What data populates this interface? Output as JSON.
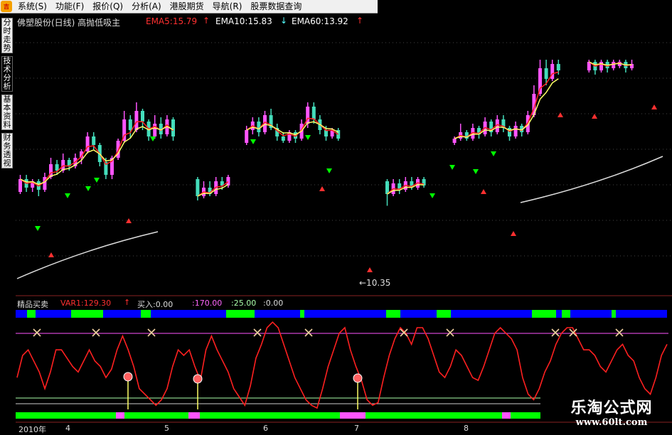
{
  "menu": [
    {
      "label": "系统(S)"
    },
    {
      "label": "功能(F)"
    },
    {
      "label": "报价(Q)"
    },
    {
      "label": "分析(A)"
    },
    {
      "label": "港股期货"
    },
    {
      "label": "导航(R)"
    },
    {
      "label": "股票数据查询"
    }
  ],
  "side_tabs": [
    "分时走势",
    "技术分析",
    "基本资料",
    "财务透视"
  ],
  "header": {
    "title": "佛塑股份(日线) 高抛低吸主",
    "ema5": "EMA5:15.79",
    "ema10": "EMA10:15.83",
    "ema60": "EMA60:13.92",
    "up_arrow": "↑",
    "down_arrow": "↓"
  },
  "price_low_label": "←10.35",
  "indicator": {
    "name": "精品买卖",
    "var1": "VAR1:129.30",
    "var1_arrow": "↑",
    "buy": "买入:0.00",
    "v170": ":170.00",
    "v25": ":25.00",
    "v0": ":0.00"
  },
  "x_axis": {
    "year": "2010年",
    "months": [
      "4",
      "5",
      "6",
      "7",
      "8"
    ]
  },
  "watermark": {
    "title": "乐淘公式网",
    "url": "www.60lt.com"
  },
  "colors": {
    "up": "#ff55ff",
    "down": "#44ddbb",
    "ema_fast": "#ff2020",
    "ema_mid": "#ffff66",
    "ema60": "#dddddd",
    "signal": "#00ff00",
    "top_bar": "#0000ff",
    "kline_red": "#ff2020"
  },
  "chart_data": {
    "type": "candlestick",
    "price_extremes": {
      "low": 10.35
    },
    "ema": {
      "EMA5": 15.79,
      "EMA10": 15.83,
      "EMA60": 13.92
    },
    "indicator_levels": [
      170,
      25,
      0
    ],
    "var1_last": 129.3,
    "osc_series": [
      60,
      100,
      110,
      90,
      70,
      40,
      70,
      110,
      110,
      95,
      80,
      70,
      90,
      110,
      90,
      80,
      60,
      75,
      110,
      135,
      110,
      80,
      40,
      30,
      20,
      10,
      20,
      40,
      80,
      110,
      100,
      110,
      80,
      55,
      110,
      135,
      110,
      90,
      70,
      40,
      25,
      10,
      45,
      95,
      120,
      150,
      160,
      150,
      120,
      90,
      60,
      40,
      20,
      10,
      5,
      40,
      80,
      110,
      140,
      150,
      110,
      80,
      55,
      20,
      10,
      15,
      60,
      100,
      130,
      150,
      140,
      120,
      150,
      150,
      130,
      100,
      70,
      60,
      80,
      110,
      100,
      80,
      60,
      55,
      80,
      110,
      140,
      150,
      140,
      130,
      110,
      60,
      30,
      20,
      40,
      70,
      90,
      120,
      140,
      150,
      150,
      130,
      110,
      110,
      100,
      80,
      70,
      90,
      110,
      120,
      100,
      90,
      60,
      40,
      30,
      60,
      100,
      120
    ],
    "candles": [
      {
        "o": 11.0,
        "c": 11.6,
        "h": 11.8,
        "l": 10.9
      },
      {
        "o": 11.6,
        "c": 11.2,
        "h": 11.8,
        "l": 11.0
      },
      {
        "o": 11.2,
        "c": 11.5,
        "h": 11.6,
        "l": 11.0
      },
      {
        "o": 11.5,
        "c": 11.1,
        "h": 11.6,
        "l": 10.8
      },
      {
        "o": 11.1,
        "c": 11.7,
        "h": 11.9,
        "l": 11.0
      },
      {
        "o": 11.7,
        "c": 12.3,
        "h": 12.6,
        "l": 11.6
      },
      {
        "o": 12.3,
        "c": 12.0,
        "h": 12.5,
        "l": 11.8
      },
      {
        "o": 12.0,
        "c": 12.5,
        "h": 12.8,
        "l": 11.9
      },
      {
        "o": 12.5,
        "c": 12.2,
        "h": 12.6,
        "l": 12.0
      },
      {
        "o": 12.2,
        "c": 12.6,
        "h": 12.8,
        "l": 12.1
      },
      {
        "o": 12.6,
        "c": 12.9,
        "h": 13.0,
        "l": 12.3
      },
      {
        "o": 12.9,
        "c": 13.6,
        "h": 13.8,
        "l": 12.8
      },
      {
        "o": 13.6,
        "c": 13.2,
        "h": 13.8,
        "l": 13.0
      },
      {
        "o": 13.2,
        "c": 12.4,
        "h": 13.3,
        "l": 12.2
      },
      {
        "o": 12.4,
        "c": 11.8,
        "h": 12.6,
        "l": 11.6
      },
      {
        "o": 11.8,
        "c": 12.6,
        "h": 12.7,
        "l": 11.6
      },
      {
        "o": 12.6,
        "c": 13.4,
        "h": 13.5,
        "l": 12.5
      },
      {
        "o": 13.4,
        "c": 14.4,
        "h": 14.8,
        "l": 13.3
      },
      {
        "o": 14.4,
        "c": 13.9,
        "h": 14.6,
        "l": 13.5
      },
      {
        "o": 13.9,
        "c": 14.8,
        "h": 15.2,
        "l": 13.8
      },
      {
        "o": 14.8,
        "c": 14.3,
        "h": 14.9,
        "l": 13.9
      },
      {
        "o": 14.3,
        "c": 13.6,
        "h": 14.4,
        "l": 13.4
      },
      {
        "o": 13.6,
        "c": 14.2,
        "h": 14.6,
        "l": 13.5
      },
      {
        "o": 14.2,
        "c": 13.7,
        "h": 14.5,
        "l": 13.5
      },
      {
        "o": 13.7,
        "c": 14.4,
        "h": 14.6,
        "l": 13.6
      },
      {
        "o": 14.4,
        "c": 13.6,
        "h": 14.5,
        "l": 13.4
      },
      {
        "o": 11.6,
        "c": 10.8,
        "h": 11.7,
        "l": 10.6
      },
      {
        "o": 10.8,
        "c": 11.2,
        "h": 11.5,
        "l": 10.7
      },
      {
        "o": 11.2,
        "c": 10.9,
        "h": 11.5,
        "l": 10.8
      },
      {
        "o": 10.9,
        "c": 11.5,
        "h": 11.7,
        "l": 10.8
      },
      {
        "o": 11.5,
        "c": 11.3,
        "h": 11.7,
        "l": 11.1
      },
      {
        "o": 11.3,
        "c": 11.7,
        "h": 11.8,
        "l": 11.2
      },
      {
        "o": 13.3,
        "c": 13.9,
        "h": 14.1,
        "l": 13.2
      },
      {
        "o": 13.9,
        "c": 14.3,
        "h": 14.5,
        "l": 13.7
      },
      {
        "o": 14.3,
        "c": 13.8,
        "h": 14.5,
        "l": 13.6
      },
      {
        "o": 13.8,
        "c": 14.6,
        "h": 14.8,
        "l": 13.7
      },
      {
        "o": 14.6,
        "c": 14.0,
        "h": 14.9,
        "l": 13.9
      },
      {
        "o": 14.0,
        "c": 13.6,
        "h": 14.2,
        "l": 13.4
      },
      {
        "o": 13.6,
        "c": 13.4,
        "h": 13.8,
        "l": 13.3
      },
      {
        "o": 13.4,
        "c": 13.8,
        "h": 13.9,
        "l": 13.3
      },
      {
        "o": 13.8,
        "c": 13.5,
        "h": 13.9,
        "l": 13.3
      },
      {
        "o": 13.5,
        "c": 14.2,
        "h": 14.4,
        "l": 13.4
      },
      {
        "o": 14.2,
        "c": 15.0,
        "h": 15.2,
        "l": 14.0
      },
      {
        "o": 15.0,
        "c": 14.4,
        "h": 15.2,
        "l": 14.2
      },
      {
        "o": 14.4,
        "c": 13.9,
        "h": 14.6,
        "l": 13.7
      },
      {
        "o": 13.9,
        "c": 13.6,
        "h": 14.1,
        "l": 13.4
      },
      {
        "o": 13.6,
        "c": 13.9,
        "h": 14.0,
        "l": 13.5
      },
      {
        "o": 13.9,
        "c": 13.5,
        "h": 14.0,
        "l": 13.4
      },
      {
        "o": 11.5,
        "c": 10.9,
        "h": 11.6,
        "l": 10.35
      },
      {
        "o": 10.9,
        "c": 11.4,
        "h": 11.6,
        "l": 10.8
      },
      {
        "o": 11.4,
        "c": 11.1,
        "h": 11.6,
        "l": 10.9
      },
      {
        "o": 11.1,
        "c": 11.5,
        "h": 11.7,
        "l": 11.0
      },
      {
        "o": 11.5,
        "c": 11.2,
        "h": 11.7,
        "l": 11.1
      },
      {
        "o": 11.2,
        "c": 11.6,
        "h": 11.7,
        "l": 11.1
      },
      {
        "o": 11.6,
        "c": 11.3,
        "h": 11.7,
        "l": 11.2
      },
      {
        "o": 13.3,
        "c": 13.5,
        "h": 13.6,
        "l": 13.2
      },
      {
        "o": 13.5,
        "c": 13.8,
        "h": 14.2,
        "l": 13.4
      },
      {
        "o": 13.8,
        "c": 13.5,
        "h": 13.9,
        "l": 13.4
      },
      {
        "o": 13.5,
        "c": 14.0,
        "h": 14.2,
        "l": 13.4
      },
      {
        "o": 14.0,
        "c": 13.7,
        "h": 14.1,
        "l": 13.5
      },
      {
        "o": 13.7,
        "c": 14.3,
        "h": 14.5,
        "l": 13.6
      },
      {
        "o": 14.3,
        "c": 13.8,
        "h": 14.4,
        "l": 13.6
      },
      {
        "o": 13.8,
        "c": 14.4,
        "h": 14.6,
        "l": 13.7
      },
      {
        "o": 14.4,
        "c": 14.0,
        "h": 14.6,
        "l": 13.8
      },
      {
        "o": 14.0,
        "c": 13.6,
        "h": 14.1,
        "l": 13.4
      },
      {
        "o": 13.6,
        "c": 14.1,
        "h": 14.3,
        "l": 13.5
      },
      {
        "o": 14.1,
        "c": 13.8,
        "h": 14.2,
        "l": 13.6
      },
      {
        "o": 13.8,
        "c": 14.6,
        "h": 14.8,
        "l": 13.7
      },
      {
        "o": 14.6,
        "c": 15.6,
        "h": 16.0,
        "l": 14.5
      },
      {
        "o": 15.6,
        "c": 16.8,
        "h": 17.2,
        "l": 15.5
      },
      {
        "o": 16.8,
        "c": 16.3,
        "h": 17.2,
        "l": 16.0
      },
      {
        "o": 16.3,
        "c": 17.0,
        "h": 17.2,
        "l": 16.2
      },
      {
        "o": 17.0,
        "c": 16.7,
        "h": 17.2,
        "l": 16.5
      },
      {
        "o": 16.7,
        "c": 17.1,
        "h": 17.2,
        "l": 16.6
      },
      {
        "o": 17.1,
        "c": 16.7,
        "h": 17.2,
        "l": 16.5
      },
      {
        "o": 16.7,
        "c": 17.1,
        "h": 17.2,
        "l": 16.6
      },
      {
        "o": 17.1,
        "c": 16.8,
        "h": 17.2,
        "l": 16.6
      },
      {
        "o": 16.8,
        "c": 17.1,
        "h": 17.2,
        "l": 16.7
      },
      {
        "o": 16.9,
        "c": 17.1,
        "h": 17.2,
        "l": 16.8
      },
      {
        "o": 17.1,
        "c": 16.8,
        "h": 17.2,
        "l": 16.6
      },
      {
        "o": 16.8,
        "c": 17.0,
        "h": 17.2,
        "l": 16.7
      }
    ]
  }
}
